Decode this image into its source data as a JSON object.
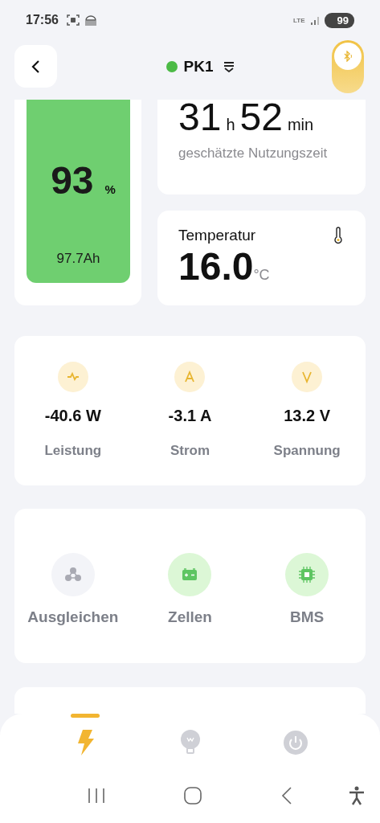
{
  "status_bar": {
    "time": "17:56",
    "network": "LTE",
    "battery": "99"
  },
  "header": {
    "title": "PK1",
    "connected": true,
    "bluetooth_on": true
  },
  "battery": {
    "percent": "93",
    "unit": "%",
    "capacity": "97.7Ah"
  },
  "runtime": {
    "hours": "31",
    "hours_unit": "h",
    "minutes": "52",
    "minutes_unit": "min",
    "caption": "geschätzte Nutzungszeit"
  },
  "temperature": {
    "label": "Temperatur",
    "value": "16.0",
    "unit": "°C"
  },
  "metrics": [
    {
      "kind": "power",
      "value": "-40.6 W",
      "label": "Leistung"
    },
    {
      "kind": "current",
      "value": "-3.1 A",
      "label": "Strom"
    },
    {
      "kind": "voltage",
      "value": "13.2 V",
      "label": "Spannung"
    }
  ],
  "actions": [
    {
      "kind": "balance",
      "label": "Ausgleichen"
    },
    {
      "kind": "cells",
      "label": "Zellen"
    },
    {
      "kind": "bms",
      "label": "BMS"
    }
  ],
  "tabs": [
    {
      "kind": "energy",
      "selected": true
    },
    {
      "kind": "light",
      "selected": false
    },
    {
      "kind": "power",
      "selected": false
    }
  ]
}
